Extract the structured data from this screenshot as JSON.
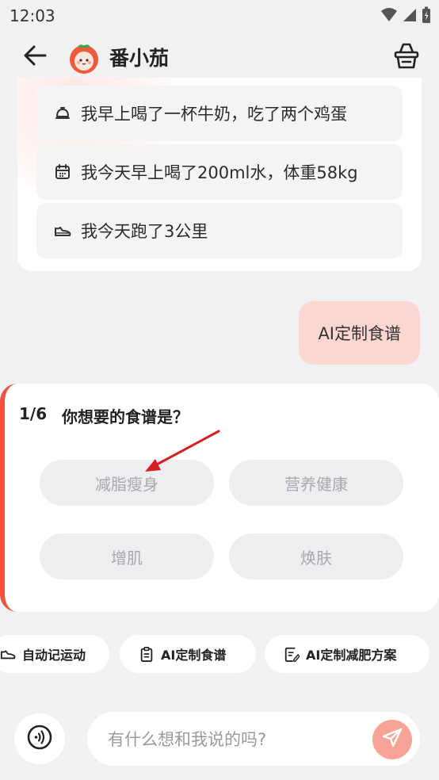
{
  "status": {
    "time": "12:03"
  },
  "header": {
    "title": "番小茄"
  },
  "suggestions": [
    {
      "icon": "dish-icon",
      "text": "我早上喝了一杯牛奶，吃了两个鸡蛋"
    },
    {
      "icon": "calendar-icon",
      "text": "我今天早上喝了200ml水，体重58kg"
    },
    {
      "icon": "shoe-icon",
      "text": "我今天跑了3公里"
    }
  ],
  "user_message": "AI定制食谱",
  "question": {
    "progress": "1/6",
    "text": "你想要的食谱是？",
    "options": [
      "减脂瘦身",
      "营养健康",
      "增肌",
      "焕肤"
    ]
  },
  "quick_actions": [
    {
      "icon": "shoe-icon",
      "label": "自动记运动"
    },
    {
      "icon": "clipboard-icon",
      "label": "AI定制食谱"
    },
    {
      "icon": "document-edit-icon",
      "label": "AI定制减肥方案"
    }
  ],
  "input": {
    "placeholder": "有什么想和我说的吗?"
  },
  "colors": {
    "accent": "#f0533f",
    "user_bubble": "#fcd7d2",
    "send_button": "#f7a496",
    "arrow": "#d42020"
  }
}
